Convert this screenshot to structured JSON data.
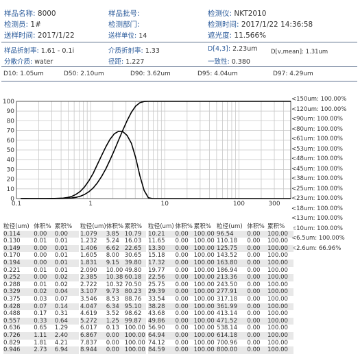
{
  "header": {
    "sample_name_label": "样品名称:",
    "sample_name": "8000",
    "batch_label": "样品批号:",
    "batch": "",
    "instrument_label": "检测仪:",
    "instrument": "NKT2010",
    "inspector_label": "检测员:",
    "inspector": "1#",
    "dept_label": "检测部门:",
    "dept": "",
    "test_time_label": "检测时间:",
    "test_time": "2017/1/22 14:36:58",
    "send_time_label": "送样时间:",
    "send_time": "2017/1/22",
    "send_unit_label": "送样单位:",
    "send_unit": "14",
    "obscuration_label": "遮光度:",
    "obscuration": "11.566%"
  },
  "optics": {
    "sample_ri_label": "样品折射率:",
    "sample_ri": "1.61 - 0.1i",
    "medium_ri_label": "介质折射率:",
    "medium_ri": "1.33",
    "d43_label": "D[4,3]:",
    "d43": "2.23um",
    "dvmean_label": "D[v,mean]:",
    "dvmean": "1.31um",
    "dispersant_label": "分散介质:",
    "dispersant": "water",
    "span_label": "径距:",
    "span": "1.227",
    "uniformity_label": "一致性:",
    "uniformity": "0.380"
  },
  "dvalues": [
    {
      "label": "D10:",
      "value": "1.05um"
    },
    {
      "label": "D50:",
      "value": "2.10um"
    },
    {
      "label": "D90:",
      "value": "3.62um"
    },
    {
      "label": "D95:",
      "value": "4.04um"
    },
    {
      "label": "D97:",
      "value": "4.29um"
    }
  ],
  "chart_data": {
    "type": "line",
    "x_scale": "log",
    "xlim": [
      0.1,
      500
    ],
    "x_ticks": [
      "0.1",
      "1",
      "10",
      "100",
      "300"
    ],
    "left_ylim": [
      0,
      100
    ],
    "left_ticks": [
      "0",
      "10",
      "20",
      "30",
      "40",
      "50",
      "60",
      "70",
      "80",
      "90",
      "100"
    ],
    "right_ylim": [
      0,
      15
    ],
    "right_ticks": [
      "1.5",
      "3",
      "4.5",
      "6",
      "7.5",
      "9",
      "10.5",
      "12",
      "13.5",
      "15"
    ],
    "grid": true,
    "series": [
      {
        "axis": "left",
        "x": [
          0.114,
          0.13,
          0.149,
          0.17,
          0.194,
          0.221,
          0.252,
          0.288,
          0.329,
          0.375,
          0.428,
          0.488,
          0.557,
          0.636,
          0.726,
          0.829,
          0.946,
          1.079,
          1.232,
          1.406,
          1.605,
          1.831,
          2.09,
          2.385,
          2.722,
          3.107,
          3.546,
          4.047,
          4.619,
          5.272,
          6.017,
          6.867,
          7.837,
          8.944,
          10.21,
          20,
          50,
          100,
          500
        ],
        "y": [
          0.0,
          0.01,
          0.01,
          0.01,
          0.01,
          0.01,
          0.02,
          0.02,
          0.04,
          0.07,
          0.14,
          0.31,
          0.64,
          1.29,
          2.4,
          4.21,
          6.94,
          10.79,
          16.03,
          22.65,
          30.65,
          39.8,
          49.8,
          60.18,
          70.5,
          80.23,
          88.76,
          95.1,
          98.62,
          99.87,
          100.0,
          100.0,
          100.0,
          100.0,
          100.0,
          100.0,
          100.0,
          100.0,
          100.0
        ]
      },
      {
        "axis": "right",
        "x": [
          0.114,
          0.13,
          0.149,
          0.17,
          0.194,
          0.221,
          0.252,
          0.288,
          0.329,
          0.375,
          0.428,
          0.488,
          0.557,
          0.636,
          0.726,
          0.829,
          0.946,
          1.079,
          1.232,
          1.406,
          1.605,
          1.831,
          2.09,
          2.385,
          2.722,
          3.107,
          3.546,
          4.047,
          4.619,
          5.272,
          6.017,
          6.867,
          7.837,
          8.944,
          10.21,
          20,
          50,
          100,
          500
        ],
        "y": [
          0.0,
          0.01,
          0.0,
          0.0,
          0.0,
          0.0,
          0.0,
          0.01,
          0.02,
          0.04,
          0.07,
          0.17,
          0.33,
          0.65,
          1.11,
          1.81,
          2.73,
          3.85,
          5.24,
          6.62,
          8.0,
          9.15,
          10.0,
          10.38,
          10.32,
          9.73,
          8.53,
          6.34,
          3.52,
          1.25,
          0.13,
          0.0,
          0.0,
          0.0,
          0.0,
          0.0,
          0.0,
          0.0,
          0.0
        ]
      }
    ]
  },
  "cumulative_legend": [
    "<150um: 100.00%",
    "<120um: 100.00%",
    "<90um: 100.00%",
    "<80um: 100.00%",
    "<61um: 100.00%",
    "<53um: 100.00%",
    "<48um: 100.00%",
    "<45um: 100.00%",
    "<38um: 100.00%",
    "<25um: 100.00%",
    "<23um: 100.00%",
    "<18um: 100.00%",
    "<13um: 100.00%",
    "<10um: 100.00%",
    "<6.5um: 100.00%",
    "<2.6um: 66.96%"
  ],
  "table_headers": [
    "粒径(um)",
    "体积%",
    "累积%"
  ],
  "table_columns": [
    [
      [
        "0.114",
        "0.00",
        "0.00"
      ],
      [
        "0.130",
        "0.01",
        "0.01"
      ],
      [
        "0.149",
        "0.00",
        "0.01"
      ],
      [
        "0.170",
        "0.00",
        "0.01"
      ],
      [
        "0.194",
        "0.00",
        "0.01"
      ],
      [
        "0.221",
        "0.01",
        "0.01"
      ],
      [
        "0.252",
        "0.00",
        "0.02"
      ],
      [
        "0.288",
        "0.01",
        "0.02"
      ],
      [
        "0.329",
        "0.02",
        "0.04"
      ],
      [
        "0.375",
        "0.03",
        "0.07"
      ],
      [
        "0.428",
        "0.07",
        "0.14"
      ],
      [
        "0.488",
        "0.17",
        "0.31"
      ],
      [
        "0.557",
        "0.33",
        "0.64"
      ],
      [
        "0.636",
        "0.65",
        "1.29"
      ],
      [
        "0.726",
        "1.11",
        "2.40"
      ],
      [
        "0.829",
        "1.81",
        "4.21"
      ],
      [
        "0.946",
        "2.73",
        "6.94"
      ]
    ],
    [
      [
        "1.079",
        "3.85",
        "10.79"
      ],
      [
        "1.232",
        "5.24",
        "16.03"
      ],
      [
        "1.406",
        "6.62",
        "22.65"
      ],
      [
        "1.605",
        "8.00",
        "30.65"
      ],
      [
        "1.831",
        "9.15",
        "39.80"
      ],
      [
        "2.090",
        "10.00",
        "49.80"
      ],
      [
        "2.385",
        "10.38",
        "60.18"
      ],
      [
        "2.722",
        "10.32",
        "70.50"
      ],
      [
        "3.107",
        "9.73",
        "80.23"
      ],
      [
        "3.546",
        "8.53",
        "88.76"
      ],
      [
        "4.047",
        "6.34",
        "95.10"
      ],
      [
        "4.619",
        "3.52",
        "98.62"
      ],
      [
        "5.272",
        "1.25",
        "99.87"
      ],
      [
        "6.017",
        "0.13",
        "100.00"
      ],
      [
        "6.867",
        "0.00",
        "100.00"
      ],
      [
        "7.837",
        "0.00",
        "100.00"
      ],
      [
        "8.944",
        "0.00",
        "100.00"
      ]
    ],
    [
      [
        "10.21",
        "0.00",
        "100.00"
      ],
      [
        "11.65",
        "0.00",
        "100.00"
      ],
      [
        "13.30",
        "0.00",
        "100.00"
      ],
      [
        "15.18",
        "0.00",
        "100.00"
      ],
      [
        "17.32",
        "0.00",
        "100.00"
      ],
      [
        "19.77",
        "0.00",
        "100.00"
      ],
      [
        "22.56",
        "0.00",
        "100.00"
      ],
      [
        "25.75",
        "0.00",
        "100.00"
      ],
      [
        "29.39",
        "0.00",
        "100.00"
      ],
      [
        "33.54",
        "0.00",
        "100.00"
      ],
      [
        "38.28",
        "0.00",
        "100.00"
      ],
      [
        "43.68",
        "0.00",
        "100.00"
      ],
      [
        "49.86",
        "0.00",
        "100.00"
      ],
      [
        "56.90",
        "0.00",
        "100.00"
      ],
      [
        "64.94",
        "0.00",
        "100.00"
      ],
      [
        "74.12",
        "0.00",
        "100.00"
      ],
      [
        "84.59",
        "0.00",
        "100.00"
      ]
    ],
    [
      [
        "96.54",
        "0.00",
        "100.00"
      ],
      [
        "110.18",
        "0.00",
        "100.00"
      ],
      [
        "125.75",
        "0.00",
        "100.00"
      ],
      [
        "143.52",
        "0.00",
        "100.00"
      ],
      [
        "163.80",
        "0.00",
        "100.00"
      ],
      [
        "186.94",
        "0.00",
        "100.00"
      ],
      [
        "213.36",
        "0.00",
        "100.00"
      ],
      [
        "243.50",
        "0.00",
        "100.00"
      ],
      [
        "277.91",
        "0.00",
        "100.00"
      ],
      [
        "317.18",
        "0.00",
        "100.00"
      ],
      [
        "361.99",
        "0.00",
        "100.00"
      ],
      [
        "413.14",
        "0.00",
        "100.00"
      ],
      [
        "471.52",
        "0.00",
        "100.00"
      ],
      [
        "538.14",
        "0.00",
        "100.00"
      ],
      [
        "614.18",
        "0.00",
        "100.00"
      ],
      [
        "700.96",
        "0.00",
        "100.00"
      ],
      [
        "800.00",
        "0.00",
        "100.00"
      ]
    ]
  ]
}
